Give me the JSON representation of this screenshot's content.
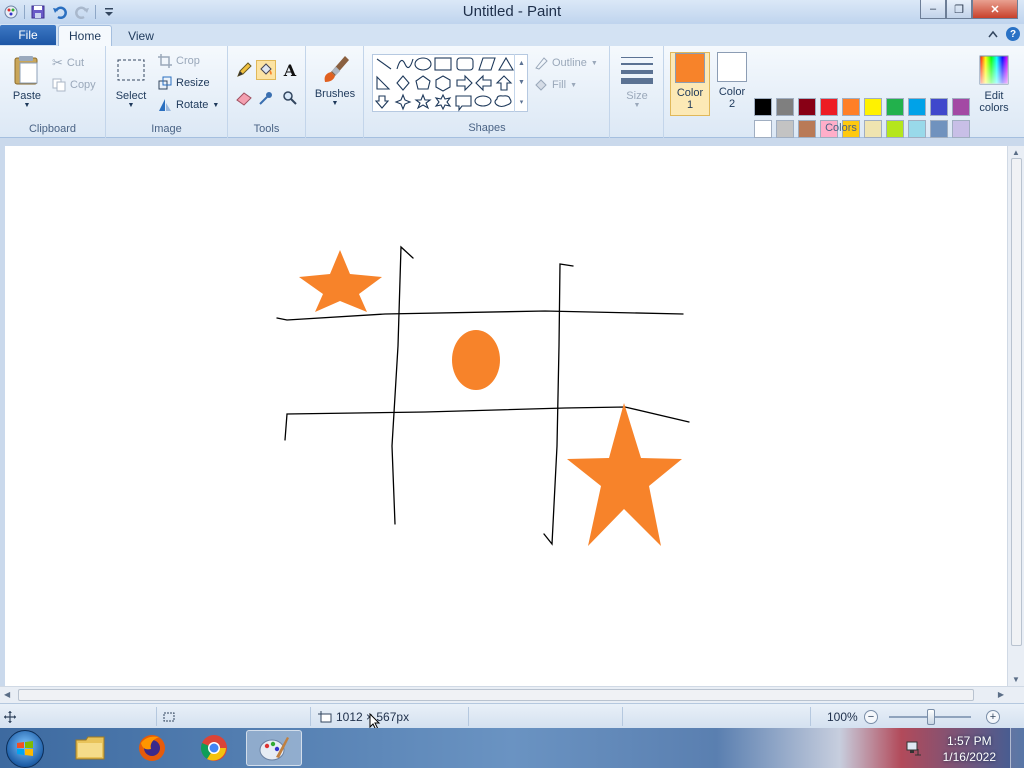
{
  "window": {
    "title": "Untitled - Paint",
    "minimize": "–",
    "maximize": "❐",
    "close": "✕"
  },
  "tabs": {
    "file": "File",
    "home": "Home",
    "view": "View"
  },
  "ribbon": {
    "clipboard": {
      "label": "Clipboard",
      "paste": "Paste",
      "cut": "Cut",
      "copy": "Copy"
    },
    "image": {
      "label": "Image",
      "select": "Select",
      "crop": "Crop",
      "resize": "Resize",
      "rotate": "Rotate"
    },
    "tools": {
      "label": "Tools"
    },
    "brushes": {
      "label": "Brushes"
    },
    "shapes": {
      "label": "Shapes",
      "outline": "Outline",
      "fill": "Fill"
    },
    "size": {
      "label": "Size"
    },
    "colors": {
      "label": "Colors",
      "color1_label": "Color",
      "color1_num": "1",
      "color2_label": "Color",
      "color2_num": "2",
      "edit_label_1": "Edit",
      "edit_label_2": "colors",
      "color1": "#f7832a",
      "color2": "#ffffff",
      "row1": [
        "#000000",
        "#7f7f7f",
        "#880015",
        "#ed1c24",
        "#ff7f27",
        "#fff200",
        "#22b14c",
        "#00a2e8",
        "#3f48cc",
        "#a349a4"
      ],
      "row2": [
        "#ffffff",
        "#c3c3c3",
        "#b97a57",
        "#ffaec9",
        "#ffc90e",
        "#efe4b0",
        "#b5e61d",
        "#99d9ea",
        "#7092be",
        "#c8bfe7"
      ]
    }
  },
  "canvas": {
    "stroke_color": "#000000",
    "shape_color": "#f7832a"
  },
  "status": {
    "canvas_size": "1012 × 567px",
    "zoom": "100%",
    "zoom_level": 100
  },
  "taskbar": {
    "apps": [
      "file-explorer-icon",
      "firefox-icon",
      "chrome-icon",
      "paint-icon"
    ],
    "time": "1:57 PM",
    "date": "1/16/2022"
  }
}
